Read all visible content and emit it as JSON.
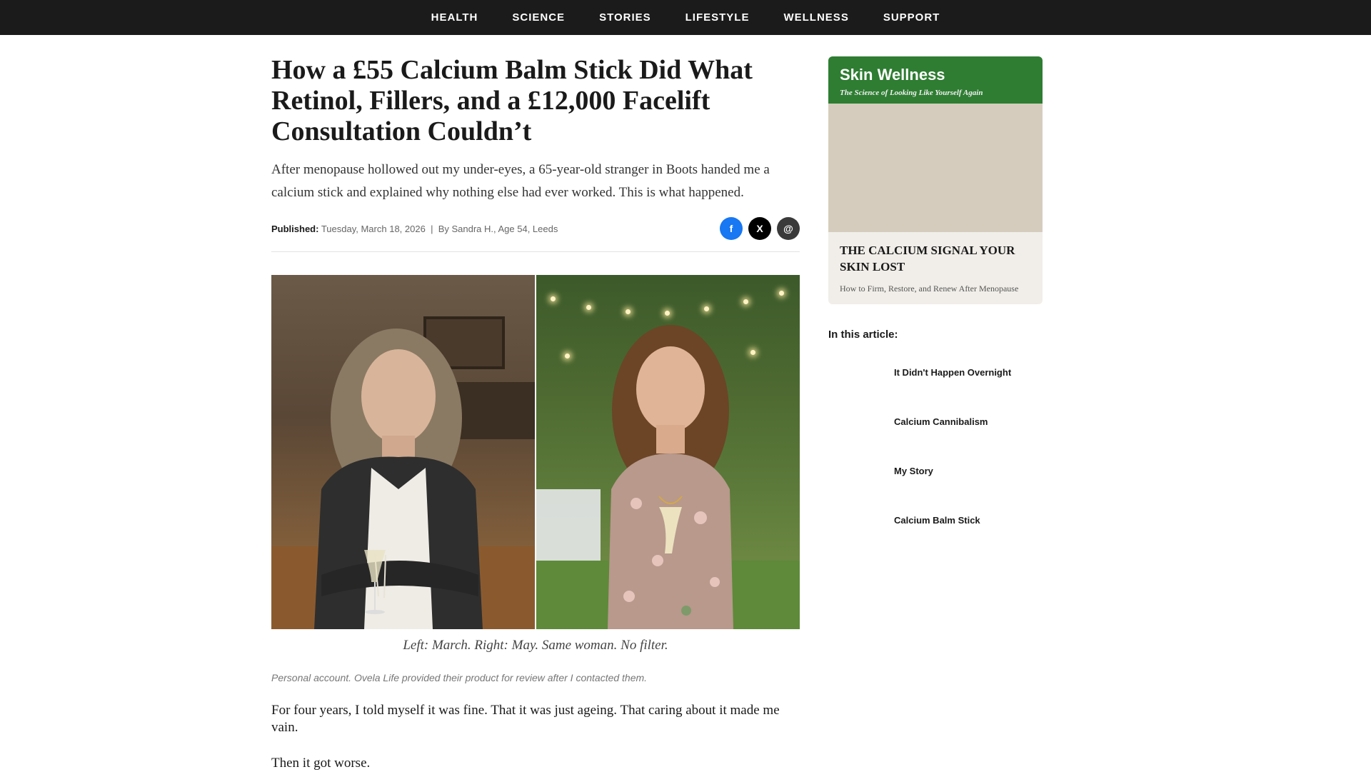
{
  "nav": {
    "items": [
      "HEALTH",
      "SCIENCE",
      "STORIES",
      "LIFESTYLE",
      "WELLNESS",
      "SUPPORT"
    ]
  },
  "article": {
    "headline": "How a £55 Calcium Balm Stick Did What Retinol, Fillers, and a £12,000 Facelift Consultation Couldn’t",
    "dek": "After menopause hollowed out my under-eyes, a 65-year-old stranger in Boots handed me a calcium stick and explained why nothing else had ever worked. This is what happened.",
    "published_label": "Published:",
    "published_date": "Tuesday, March 18, 2026",
    "separator": "|",
    "byline": "By Sandra H., Age 54, Leeds",
    "share": {
      "facebook": "f",
      "x": "X",
      "email": "@"
    },
    "caption": "Left: March. Right: May. Same woman. No filter.",
    "disclosure": "Personal account. Ovela Life provided their product for review after I contacted them.",
    "paragraphs": [
      "For four years, I told myself it was fine. That it was just ageing. That caring about it made me vain.",
      "Then it got worse."
    ]
  },
  "sidebar": {
    "promo": {
      "title": "Skin Wellness",
      "tagline": "The Science of Looking Like Yourself Again",
      "headline": "THE CALCIUM SIGNAL YOUR SKIN LOST",
      "subtitle": "How to Firm, Restore, and Renew After Menopause"
    },
    "toc_title": "In this article:",
    "toc": [
      "It Didn't Happen Overnight",
      "Calcium Cannibalism",
      "My Story",
      "Calcium Balm Stick"
    ]
  },
  "colors": {
    "nav_bg": "#1b1b1b",
    "promo_green": "#2e7d32",
    "facebook": "#1877f2"
  }
}
